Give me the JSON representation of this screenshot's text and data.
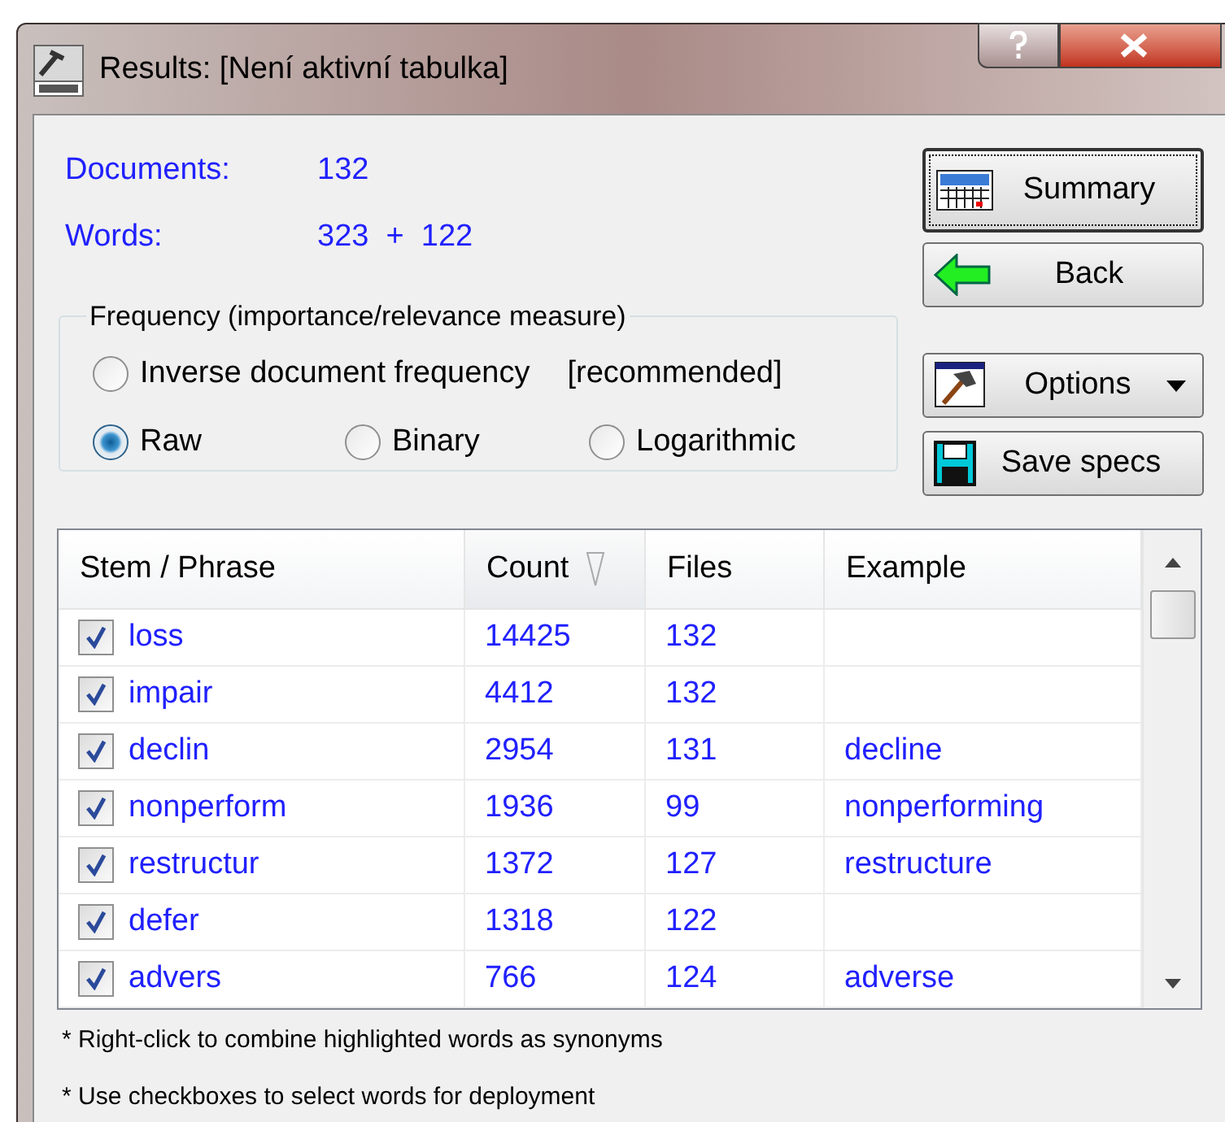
{
  "window": {
    "title": "Results: [Není aktivní tabulka]"
  },
  "stats": [
    {
      "label": "Documents:",
      "value": "132"
    },
    {
      "label": "Words:",
      "value": "323  +  122"
    }
  ],
  "frequency": {
    "legend": "Frequency (importance/relevance measure)",
    "options": [
      {
        "label": "Inverse document frequency",
        "note": "[recommended]",
        "selected": false
      },
      {
        "label": "Raw",
        "selected": true
      },
      {
        "label": "Binary",
        "selected": false
      },
      {
        "label": "Logarithmic",
        "selected": false
      }
    ]
  },
  "buttons": [
    {
      "label": "Summary",
      "kind": "summary",
      "focused": true
    },
    {
      "label": "Back",
      "kind": "back",
      "focused": false
    },
    {
      "label": "Options",
      "kind": "options",
      "focused": false
    },
    {
      "label": "Save specs",
      "kind": "save",
      "focused": false
    }
  ],
  "table": {
    "columns": [
      {
        "label": "Stem / Phrase",
        "sorted": false
      },
      {
        "label": "Count",
        "sorted": true
      },
      {
        "label": "Files",
        "sorted": false
      },
      {
        "label": "Example",
        "sorted": false
      }
    ],
    "rows": [
      {
        "checked": true,
        "stem": "loss",
        "count": "14425",
        "files": "132"
      },
      {
        "checked": true,
        "stem": "impair",
        "count": "4412",
        "files": "132"
      },
      {
        "checked": true,
        "stem": "declin",
        "count": "2954",
        "files": "131",
        "example": "decline"
      },
      {
        "checked": true,
        "stem": "nonperform",
        "count": "1936",
        "files": "99",
        "example": "nonperforming"
      },
      {
        "checked": true,
        "stem": "restructur",
        "count": "1372",
        "files": "127",
        "example": "restructure"
      },
      {
        "checked": true,
        "stem": "defer",
        "count": "1318",
        "files": "122"
      },
      {
        "checked": true,
        "stem": "advers",
        "count": "766",
        "files": "124",
        "example": "adverse"
      }
    ]
  },
  "notes": [
    "* Right-click to combine highlighted words as synonyms",
    "* Use checkboxes to select words for deployment"
  ]
}
